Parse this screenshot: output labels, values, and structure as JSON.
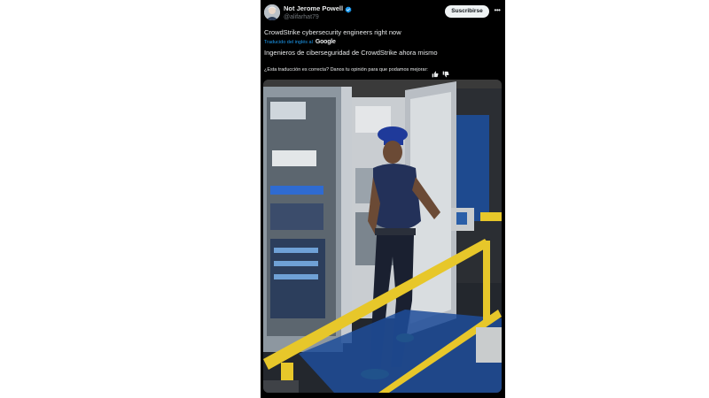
{
  "post": {
    "author": {
      "display_name": "Not Jerome Powell",
      "handle": "@alifarhat79",
      "verified": true,
      "avatar_icon": "profile-avatar"
    },
    "subscribe_label": "Suscribirse",
    "more_icon": "more-options-icon",
    "text": "CrowdStrike cybersecurity engineers right now",
    "translation": {
      "translated_by": "Traducido del inglés al",
      "provider": "Google",
      "text": "Ingenieros de ciberseguridad de CrowdStrike ahora mismo"
    },
    "feedback": {
      "question": "¿Esta traducción es correcta? Danos tu opinión para que podamos mejorar:",
      "thumbs_up_icon": "thumbs-up-icon",
      "thumbs_down_icon": "thumbs-down-icon"
    },
    "media": {
      "type": "photo",
      "content": "man in blue cap and shirt standing at open electrical control cabinets behind a yellow railing"
    }
  },
  "colors": {
    "background": "#000000",
    "text": "#e7e9ea",
    "muted": "#71767b",
    "link": "#1d9bf0",
    "verified": "#1d9bf0",
    "button": "#eff3f4"
  }
}
